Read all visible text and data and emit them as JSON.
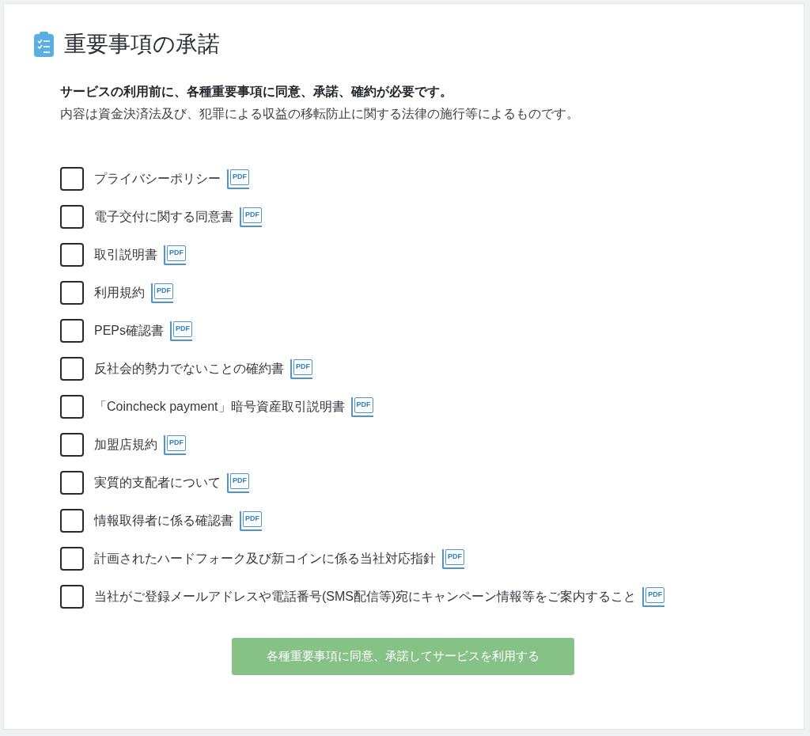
{
  "header": {
    "title": "重要事項の承諾"
  },
  "intro": {
    "lead": "サービスの利用前に、各種重要事項に同意、承諾、確約が必要です。",
    "note": "内容は資金決済法及び、犯罪による収益の移転防止に関する法律の施行等によるものです。"
  },
  "agreements": [
    {
      "label": "プライバシーポリシー",
      "checked": false,
      "pdf_label": "PDF"
    },
    {
      "label": "電子交付に関する同意書",
      "checked": false,
      "pdf_label": "PDF"
    },
    {
      "label": "取引説明書",
      "checked": false,
      "pdf_label": "PDF"
    },
    {
      "label": "利用規約",
      "checked": false,
      "pdf_label": "PDF"
    },
    {
      "label": "PEPs確認書",
      "checked": false,
      "pdf_label": "PDF"
    },
    {
      "label": "反社会的勢力でないことの確約書",
      "checked": false,
      "pdf_label": "PDF"
    },
    {
      "label": "「Coincheck payment」暗号資産取引説明書",
      "checked": false,
      "pdf_label": "PDF"
    },
    {
      "label": "加盟店規約",
      "checked": false,
      "pdf_label": "PDF"
    },
    {
      "label": "実質的支配者について",
      "checked": false,
      "pdf_label": "PDF"
    },
    {
      "label": "情報取得者に係る確認書",
      "checked": false,
      "pdf_label": "PDF"
    },
    {
      "label": "計画されたハードフォーク及び新コインに係る当社対応指針",
      "checked": false,
      "pdf_label": "PDF"
    },
    {
      "label": "当社がご登録メールアドレスや電話番号(SMS配信等)宛にキャンペーン情報等をご案内すること",
      "checked": false,
      "pdf_label": "PDF"
    }
  ],
  "submit_button": {
    "label": "各種重要事項に同意、承諾してサービスを利用する",
    "disabled": true
  }
}
